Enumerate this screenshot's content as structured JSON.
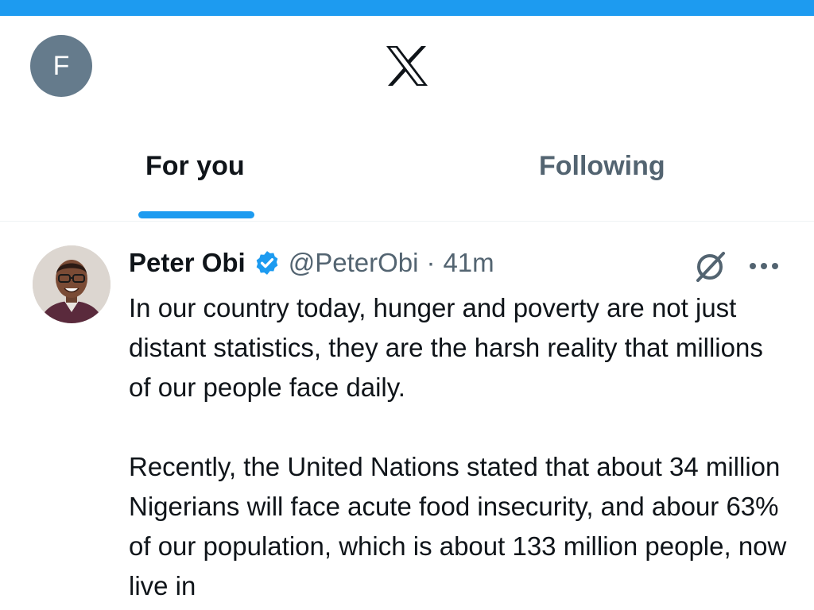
{
  "header": {
    "user_initial": "F",
    "logo": "x-logo-icon"
  },
  "tabs": [
    {
      "label": "For you",
      "active": true
    },
    {
      "label": "Following",
      "active": false
    }
  ],
  "tweet": {
    "author_name": "Peter Obi",
    "verified": true,
    "handle": "@PeterObi",
    "separator": "·",
    "time": "41m",
    "paragraphs": [
      "In our country today, hunger and poverty are not just distant statistics, they are the harsh reality that millions of our people face daily.",
      "Recently, the United Nations stated that about 34 million Nigerians will face acute food insecurity, and abour 63% of our population, which is about 133 million people,  now live in"
    ]
  },
  "colors": {
    "accent": "#1d9bf0",
    "text_primary": "#0f1419",
    "text_secondary": "#536471",
    "user_avatar_bg": "#657b8c"
  },
  "icons": {
    "grok": "grok-icon",
    "more": "more-horizontal-icon",
    "verified": "verified-badge-icon"
  }
}
